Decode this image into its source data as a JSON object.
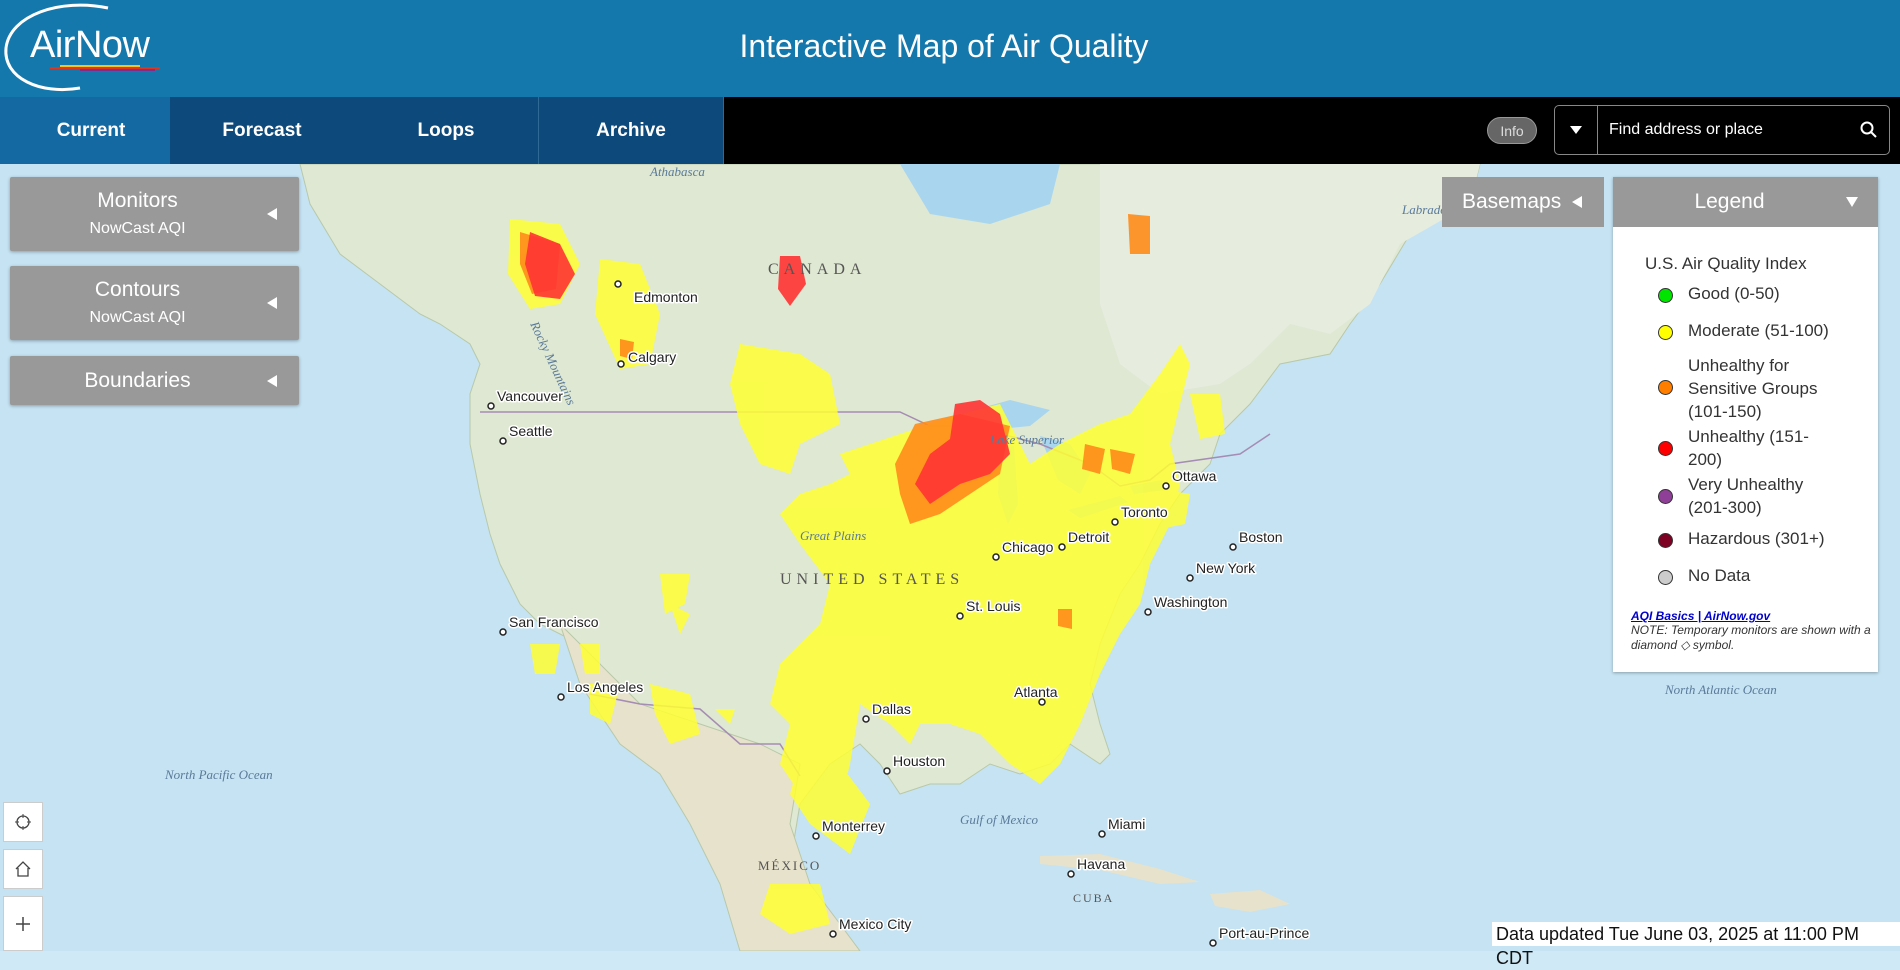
{
  "header": {
    "logo_text": "AirNow",
    "title": "Interactive Map of Air Quality"
  },
  "nav": {
    "tabs": [
      {
        "label": "Current",
        "active": true
      },
      {
        "label": "Forecast",
        "active": false
      },
      {
        "label": "Loops",
        "active": false
      },
      {
        "label": "Archive",
        "active": false
      }
    ],
    "info_label": "Info",
    "search_placeholder": "Find address or place"
  },
  "layers": [
    {
      "title": "Monitors",
      "subtitle": "NowCast AQI"
    },
    {
      "title": "Contours",
      "subtitle": "NowCast AQI"
    },
    {
      "title": "Boundaries",
      "subtitle": ""
    }
  ],
  "basemaps_label": "Basemaps",
  "legend": {
    "title": "Legend",
    "subtitle": "U.S. Air Quality Index",
    "items": [
      {
        "label": "Good (0-50)",
        "color": "#00e400"
      },
      {
        "label": "Moderate (51-100)",
        "color": "#ffff00"
      },
      {
        "label": "Unhealthy for Sensitive Groups (101-150)",
        "color": "#ff7e00"
      },
      {
        "label": "Unhealthy (151-200)",
        "color": "#ff0000"
      },
      {
        "label": "Very Unhealthy (201-300)",
        "color": "#8f3f97"
      },
      {
        "label": "Hazardous (301+)",
        "color": "#7e0023"
      },
      {
        "label": "No Data",
        "color": "#cccccc"
      }
    ],
    "link_text": "AQI Basics | AirNow.gov",
    "note": "NOTE: Temporary monitors are shown with a diamond ◇ symbol."
  },
  "map": {
    "cities": [
      "Edmonton",
      "Calgary",
      "Vancouver",
      "Seattle",
      "San Francisco",
      "Los Angeles",
      "Dallas",
      "Houston",
      "Monterrey",
      "Mexico City",
      "Chicago",
      "St. Louis",
      "Detroit",
      "Toronto",
      "Ottawa",
      "Boston",
      "New York",
      "Washington",
      "Atlanta",
      "Miami",
      "Havana",
      "Port-au-Prince"
    ],
    "regions": [
      "CANADA",
      "UNITED STATES",
      "MÉXICO",
      "CUBA"
    ],
    "places": [
      "Athabasca",
      "Rocky Mountains",
      "Great Plains",
      "Lake Superior",
      "Gulf of Mexico",
      "North Pacific Ocean",
      "North Atlantic Ocean",
      "Labrador Sea"
    ]
  },
  "controls": [
    "locate-icon",
    "home-icon",
    "zoom-in-icon"
  ],
  "status": {
    "updated": "Data updated Tue June 03, 2025 at 11:00 PM CDT"
  }
}
